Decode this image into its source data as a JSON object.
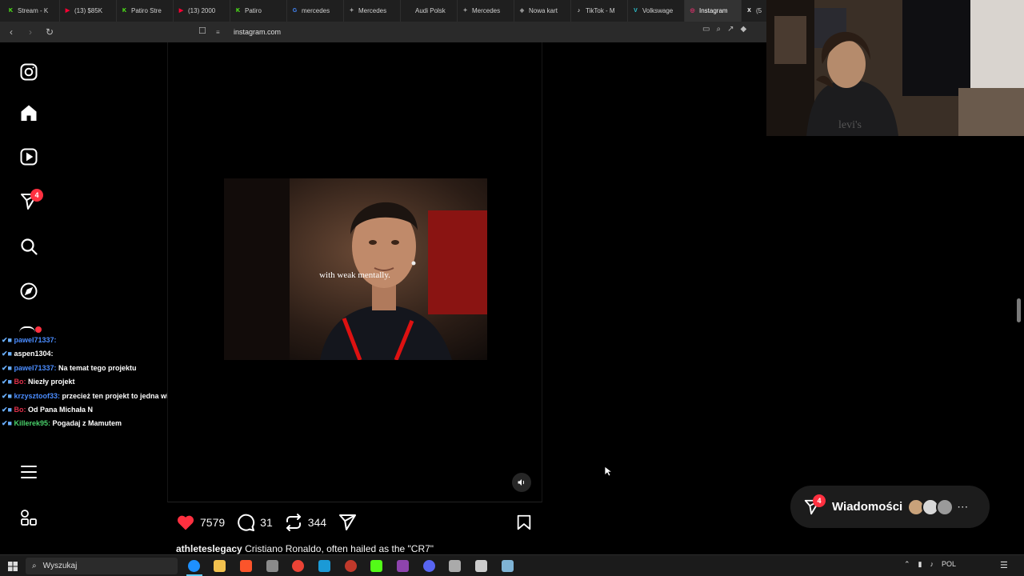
{
  "browser": {
    "tabs": [
      {
        "label": "Stream - K",
        "fav_color": "#53fc18",
        "fav_glyph": "K"
      },
      {
        "label": "(13) $85K",
        "fav_color": "#ff0033",
        "fav_glyph": "▶"
      },
      {
        "label": "Patiro Stre",
        "fav_color": "#53fc18",
        "fav_glyph": "K"
      },
      {
        "label": "(13) 2000",
        "fav_color": "#ff0033",
        "fav_glyph": "▶"
      },
      {
        "label": "Patiro",
        "fav_color": "#53fc18",
        "fav_glyph": "K"
      },
      {
        "label": "mercedes",
        "fav_color": "#4285f4",
        "fav_glyph": "G"
      },
      {
        "label": "Mercedes",
        "fav_color": "#9a9a9a",
        "fav_glyph": "✦"
      },
      {
        "label": "Audi Polsk",
        "fav_color": "#1f1f1f",
        "fav_glyph": ""
      },
      {
        "label": "Mercedes",
        "fav_color": "#9a9a9a",
        "fav_glyph": "✦"
      },
      {
        "label": "Nowa kart",
        "fav_color": "#9a9a9a",
        "fav_glyph": "◈"
      },
      {
        "label": "TikTok - M",
        "fav_color": "#ffffff",
        "fav_glyph": "♪"
      },
      {
        "label": "Volkswage",
        "fav_color": "#2cc3d0",
        "fav_glyph": "V"
      },
      {
        "label": "Instagram",
        "fav_color": "#e1306c",
        "fav_glyph": "◎"
      },
      {
        "label": "(5",
        "fav_color": "#ffffff",
        "fav_glyph": "X"
      }
    ],
    "active_tab_index": 12,
    "url": "instagram.com"
  },
  "chat": [
    {
      "name": "pawel71337",
      "message": "",
      "name_color": "blue"
    },
    {
      "name": "aspen1304",
      "message": "",
      "name_color": "white"
    },
    {
      "name": "pawel71337",
      "message": "Na temat tego projektu",
      "name_color": "blue"
    },
    {
      "name": "Bo",
      "message": "Niezły projekt",
      "name_color": "red"
    },
    {
      "name": "krzysztoof33",
      "message": "przecież ten projekt to jedna wielka ściema",
      "name_color": "blue"
    },
    {
      "name": "Bo",
      "message": "Od Pana Michała N",
      "name_color": "red"
    },
    {
      "name": "Killerek95",
      "message": "Pogadaj z Mamutem",
      "name_color": "green"
    }
  ],
  "sidebar": {
    "notifications_badge": "4"
  },
  "reel": {
    "subtitle": "with weak mentally.",
    "likes": "7579",
    "comments": "31",
    "reposts": "344",
    "caption_user": "athleteslegacy",
    "caption_text": "Cristiano Ronaldo, often hailed as the \"CR7\""
  },
  "messages": {
    "label": "Wiadomości",
    "badge": "4",
    "avatar_colors": [
      "#c9a27a",
      "#d8d8d8",
      "#9a9a9a"
    ]
  },
  "taskbar": {
    "search_placeholder": "Wyszukaj",
    "language": "POL"
  },
  "colors": {
    "like": "#ff3040",
    "badge": "#ff3040"
  }
}
